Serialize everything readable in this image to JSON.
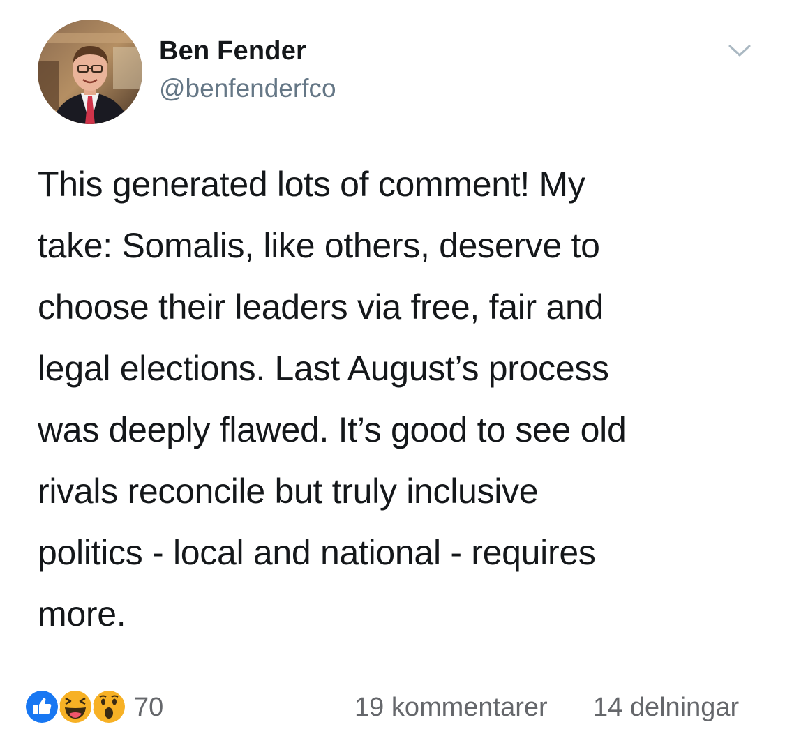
{
  "tweet": {
    "author": {
      "display_name": "Ben Fender",
      "handle": "@benfenderfco",
      "avatar_icon": "profile-photo"
    },
    "menu_icon": "chevron-down-icon",
    "text_lines": [
      "This generated lots of comment!  My",
      "take: Somalis, like others, deserve to",
      "choose their leaders via free, fair and",
      "legal elections.  Last August’s process",
      "was deeply flawed.  It’s good to see old",
      "rivals reconcile but truly inclusive",
      "politics - local and national - requires",
      "more."
    ]
  },
  "reactions": {
    "icons": [
      "like-icon",
      "haha-icon",
      "wow-icon"
    ],
    "count": "70",
    "comments": "19 kommentarer",
    "shares": "14 delningar"
  },
  "colors": {
    "like_blue": "#1877f2",
    "emoji_yellow": "#f7b125",
    "muted_text": "#65676b",
    "handle_gray": "#657786",
    "divider": "#e4e6eb"
  }
}
